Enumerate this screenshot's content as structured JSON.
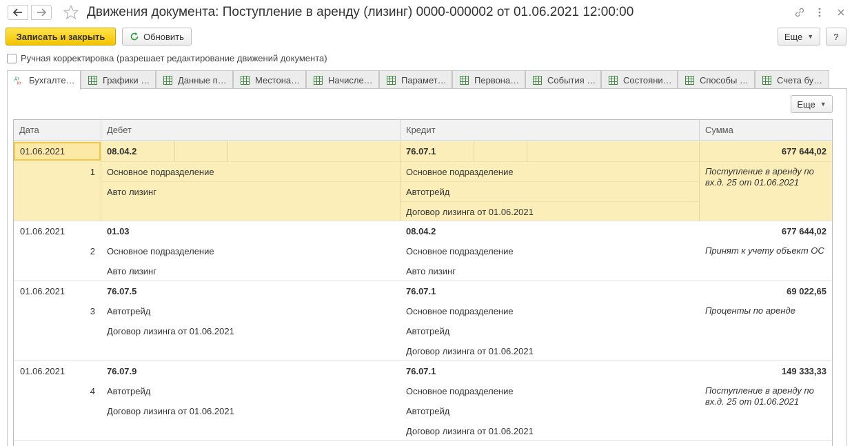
{
  "window": {
    "title": "Движения документа: Поступление в аренду (лизинг) 0000-000002 от 01.06.2021 12:00:00"
  },
  "toolbar": {
    "save_close": "Записать и закрыть",
    "refresh": "Обновить",
    "more": "Еще",
    "help": "?"
  },
  "manual_edit": {
    "label": "Ручная корректировка (разрешает редактирование движений документа)",
    "checked": false
  },
  "tabs": [
    {
      "label": "Бухгалте…",
      "icon": "dt-kt-icon",
      "active": true
    },
    {
      "label": "Графики …",
      "icon": "table-icon"
    },
    {
      "label": "Данные п…",
      "icon": "table-icon"
    },
    {
      "label": "Местона…",
      "icon": "table-icon"
    },
    {
      "label": "Начисле…",
      "icon": "table-icon"
    },
    {
      "label": "Парамет…",
      "icon": "table-icon"
    },
    {
      "label": "Первона…",
      "icon": "table-icon"
    },
    {
      "label": "События …",
      "icon": "table-icon"
    },
    {
      "label": "Состояни…",
      "icon": "table-icon"
    },
    {
      "label": "Способы …",
      "icon": "table-icon"
    },
    {
      "label": "Счета бу…",
      "icon": "table-icon"
    }
  ],
  "grid": {
    "more": "Еще",
    "headers": {
      "date": "Дата",
      "debit": "Дебет",
      "credit": "Кредит",
      "sum": "Сумма"
    },
    "rows": [
      {
        "date": "01.06.2021",
        "n": "1",
        "debit_account": "08.04.2",
        "debit_sub": [
          "Основное подразделение",
          "Авто лизинг"
        ],
        "credit_account": "76.07.1",
        "credit_sub": [
          "Основное подразделение",
          "Автотрейд",
          "Договор лизинга от 01.06.2021"
        ],
        "sum": "677 644,02",
        "comment": "Поступление в аренду по вх.д. 25 от 01.06.2021"
      },
      {
        "date": "01.06.2021",
        "n": "2",
        "debit_account": "01.03",
        "debit_sub": [
          "Основное подразделение",
          "Авто лизинг"
        ],
        "credit_account": "08.04.2",
        "credit_sub": [
          "Основное подразделение",
          "Авто лизинг"
        ],
        "sum": "677 644,02",
        "comment": "Принят к учету объект ОС"
      },
      {
        "date": "01.06.2021",
        "n": "3",
        "debit_account": "76.07.5",
        "debit_sub": [
          "Автотрейд",
          "Договор лизинга от 01.06.2021"
        ],
        "credit_account": "76.07.1",
        "credit_sub": [
          "Основное подразделение",
          "Автотрейд",
          "Договор лизинга от 01.06.2021"
        ],
        "sum": "69 022,65",
        "comment": "Проценты по аренде"
      },
      {
        "date": "01.06.2021",
        "n": "4",
        "debit_account": "76.07.9",
        "debit_sub": [
          "Автотрейд",
          "Договор лизинга от 01.06.2021"
        ],
        "credit_account": "76.07.1",
        "credit_sub": [
          "Основное подразделение",
          "Автотрейд",
          "Договор лизинга от 01.06.2021"
        ],
        "sum": "149 333,33",
        "comment": "Поступление в аренду по вх.д. 25 от 01.06.2021"
      }
    ]
  }
}
